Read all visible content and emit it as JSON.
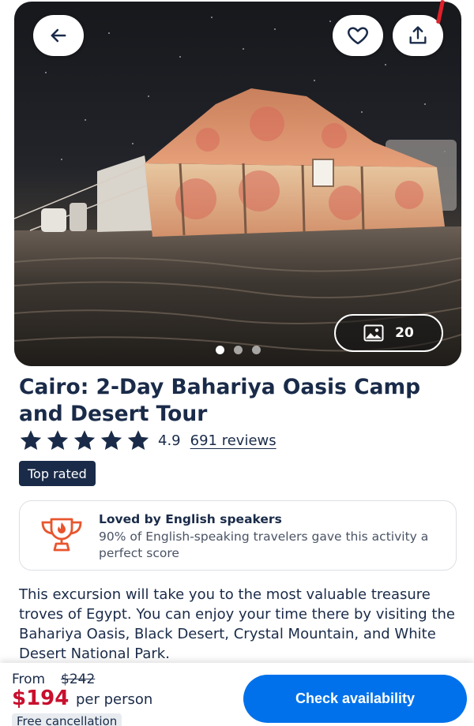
{
  "tour": {
    "title": "Cairo: 2-Day Bahariya Oasis Camp and Desert Tour",
    "rating": "4.9",
    "reviews_label": "691 reviews",
    "badge": "Top rated",
    "star_count": 5
  },
  "gallery": {
    "photo_count": "20",
    "slide_count": 3,
    "active_slide": 1
  },
  "loved": {
    "title": "Loved by English speakers",
    "description": "90% of English-speaking travelers gave this activity a perfect score"
  },
  "description": "This excursion will take you to the most valuable treasure troves of Egypt. You can enjoy your time there by visiting the Bahariya Oasis, Black Desert, Crystal Mountain, and White Desert National Park.",
  "booking": {
    "from_label": "From",
    "old_price": "$242",
    "price": "$194",
    "per_person": "per person",
    "free_cancellation": "Free cancellation",
    "cta": "Check availability"
  },
  "icons": {
    "back": "arrow-left-icon",
    "favorite": "heart-icon",
    "share": "share-icon",
    "gallery": "image-icon",
    "star": "star-icon",
    "trophy": "trophy-icon"
  },
  "colors": {
    "text": "#1a2b49",
    "price": "#c8102e",
    "cta": "#0071eb",
    "trophy": "#e8552d",
    "badge_bg": "#1a2b49"
  }
}
